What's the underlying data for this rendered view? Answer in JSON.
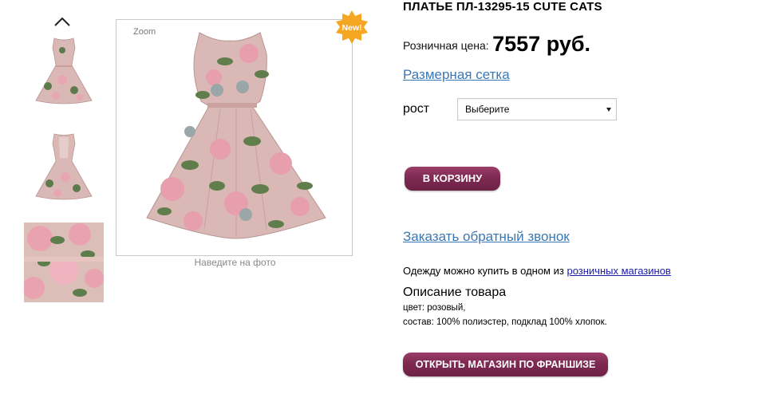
{
  "gallery": {
    "zoom_label": "Zoom",
    "new_badge": "New!",
    "hover_hint": "Наведите на фото",
    "thumbnails": [
      "dress-front",
      "dress-back",
      "fabric-detail"
    ]
  },
  "product": {
    "title": "ПЛАТЬЕ ПЛ-13295-15 CUTE CATS",
    "price_label": "Розничная цена:",
    "price_value": "7557 руб.",
    "size_chart_link": "Размерная сетка",
    "size_label": "рост",
    "size_select_value": "Выберите",
    "cart_button": "В КОРЗИНУ",
    "callback_link": "Заказать обратный звонок",
    "shops_text": "Одежду можно купить в одном из",
    "shops_link": "розничных магазинов",
    "description_title": "Описание товара",
    "description_lines": [
      "цвет: розовый,",
      "состав: 100% полиэстер, подклад 100% хлопок."
    ],
    "franchise_button": "ОТКРЫТЬ МАГАЗИН ПО ФРАНШИЗЕ"
  },
  "colors": {
    "button_gradient_top": "#9b3d68",
    "button_gradient_bottom": "#6d2145",
    "link_blue": "#3a78b5",
    "badge_orange": "#f5a623",
    "dress_pink": "#d9b8b5"
  }
}
